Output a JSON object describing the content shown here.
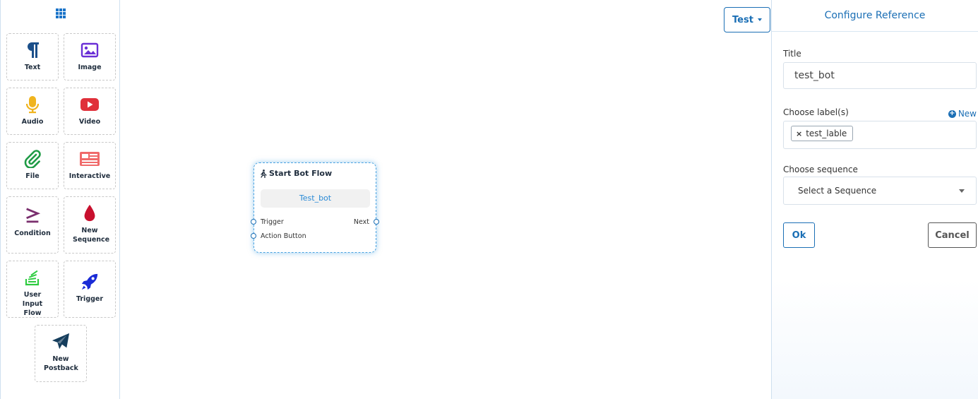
{
  "palette": {
    "tiles": [
      {
        "label": "Text",
        "icon": "paragraph-icon"
      },
      {
        "label": "Image",
        "icon": "image-icon"
      },
      {
        "label": "Audio",
        "icon": "microphone-icon"
      },
      {
        "label": "Video",
        "icon": "youtube-icon"
      },
      {
        "label": "File",
        "icon": "paperclip-icon"
      },
      {
        "label": "Interactive",
        "icon": "newspaper-icon"
      },
      {
        "label": "Condition",
        "icon": "greater-equal-icon"
      },
      {
        "label": "New Sequence",
        "icon": "droplet-icon"
      },
      {
        "label": "User Input Flow",
        "icon": "stack-overflow-icon"
      },
      {
        "label": "Trigger",
        "icon": "rocket-icon"
      },
      {
        "label": "New Postback",
        "icon": "paper-plane-icon"
      }
    ]
  },
  "toolbar": {
    "test_label": "Test"
  },
  "node": {
    "title": "Start Bot Flow",
    "pill": "Test_bot",
    "trigger": "Trigger",
    "next": "Next",
    "action_button": "Action Button"
  },
  "panel": {
    "heading": "Configure Reference",
    "title_label": "Title",
    "title_value": "test_bot",
    "labels_label": "Choose label(s)",
    "new_link": "New",
    "labels": [
      "test_lable"
    ],
    "sequence_label": "Choose sequence",
    "sequence_placeholder": "Select a Sequence",
    "ok": "Ok",
    "cancel": "Cancel"
  },
  "colors": {
    "accent": "#1b6fb5",
    "node_glow": "#4aa3e0"
  }
}
